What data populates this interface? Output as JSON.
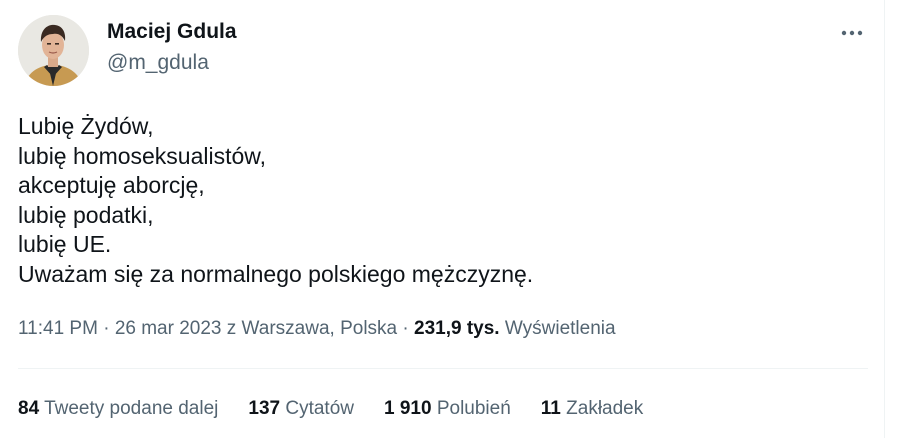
{
  "author": {
    "display_name": "Maciej Gdula",
    "handle": "@m_gdula"
  },
  "menu": {
    "icon": "more-horizontal-icon"
  },
  "tweet": {
    "lines": [
      "Lubię Żydów,",
      "lubię homoseksualistów,",
      "akceptuję aborcję,",
      "lubię podatki,",
      "lubię UE.",
      "Uważam się za normalnego polskiego mężczyznę."
    ]
  },
  "meta": {
    "time": "11:41 PM",
    "separator": "·",
    "date": "26 mar 2023",
    "location": "z Warszawa, Polska",
    "views_count": "231,9 tys.",
    "views_label": "Wyświetlenia"
  },
  "stats": [
    {
      "count": "84",
      "label": "Tweety podane dalej"
    },
    {
      "count": "137",
      "label": "Cytatów"
    },
    {
      "count": "1 910",
      "label": "Polubień"
    },
    {
      "count": "11",
      "label": "Zakładek"
    }
  ],
  "colors": {
    "text_primary": "#0f1419",
    "text_secondary": "#536471",
    "divider": "#eff3f4"
  }
}
